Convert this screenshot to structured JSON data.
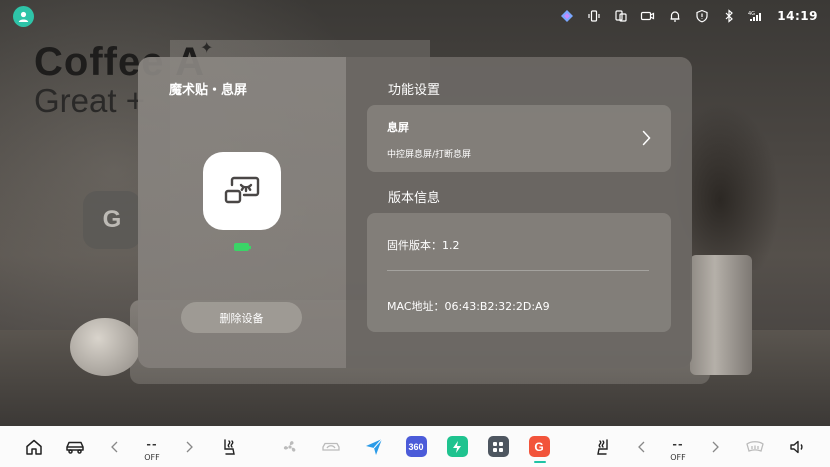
{
  "status_bar": {
    "time": "14:19",
    "icons": [
      "app-logo-icon",
      "vibrate-icon",
      "phone-link-icon",
      "camera-icon",
      "bell-icon",
      "shield-icon",
      "bluetooth-icon",
      "cellular-4g-icon"
    ],
    "network_label": "4G"
  },
  "background": {
    "headline": "Coffee A",
    "subline": "Great +",
    "tile_glyph": "G"
  },
  "dialog": {
    "device_name": "魔术贴・息屏",
    "delete_button": "删除设备",
    "battery_level": 1.0,
    "battery_color": "#3ad467",
    "function_section": {
      "title": "功能设置",
      "item_label": "息屏",
      "item_sub": "中控屏息屏/打断息屏"
    },
    "version_section": {
      "title": "版本信息",
      "firmware": "固件版本：1.2",
      "mac": "MAC地址：06:43:B2:32:2D:A9"
    }
  },
  "dock": {
    "left_temp_value": "--",
    "left_temp_state": "OFF",
    "right_temp_value": "--",
    "right_temp_state": "OFF",
    "apps": [
      {
        "name": "send-app",
        "color": "#2a9be8"
      },
      {
        "name": "360-app",
        "label": "360",
        "color": "#4b5bd9"
      },
      {
        "name": "power-app",
        "color": "#1fc38f"
      },
      {
        "name": "grid-app",
        "color": "#4e5660"
      },
      {
        "name": "g-app",
        "label": "G",
        "color": "#f2543b"
      }
    ],
    "active_indicator_color": "#20c3a5"
  }
}
